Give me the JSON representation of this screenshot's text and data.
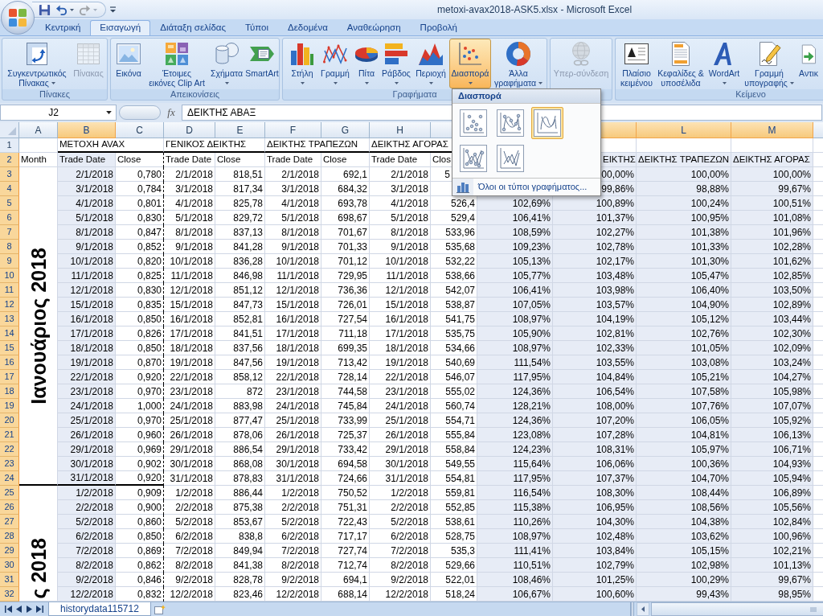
{
  "window": {
    "title": "metoxi-avax2018-ASK5.xlsx - Microsoft Excel"
  },
  "quick_access": [
    {
      "kind": "save",
      "disabled": false,
      "dropdown": false
    },
    {
      "kind": "undo",
      "disabled": false,
      "dropdown": true
    },
    {
      "kind": "redo",
      "disabled": true,
      "dropdown": true
    }
  ],
  "tabs": [
    {
      "label": "Κεντρική",
      "selected": false
    },
    {
      "label": "Εισαγωγή",
      "selected": true
    },
    {
      "label": "Διάταξη σελίδας",
      "selected": false
    },
    {
      "label": "Τύποι",
      "selected": false
    },
    {
      "label": "Δεδομένα",
      "selected": false
    },
    {
      "label": "Αναθεώρηση",
      "selected": false
    },
    {
      "label": "Προβολή",
      "selected": false
    }
  ],
  "ribbon": {
    "groups": [
      {
        "label": "Πίνακες",
        "buttons": [
          {
            "kind": "pivot_table",
            "lines": [
              "Συγκεντρωτικός",
              "Πίνακας"
            ],
            "dropdown": true,
            "disabled": false,
            "pressed": false
          },
          {
            "kind": "table",
            "lines": [
              "Πίνακας"
            ],
            "dropdown": false,
            "disabled": true,
            "pressed": false
          }
        ]
      },
      {
        "label": "Απεικονίσεις",
        "buttons": [
          {
            "kind": "picture",
            "lines": [
              "Εικόνα"
            ],
            "dropdown": false,
            "disabled": false,
            "pressed": false
          },
          {
            "kind": "clip_art",
            "lines": [
              "Έτοιμες",
              "εικόνες Clip Art"
            ],
            "dropdown": false,
            "disabled": false,
            "pressed": false
          },
          {
            "kind": "shapes",
            "lines": [
              "Σχήματα"
            ],
            "dropdown": true,
            "disabled": false,
            "pressed": false
          },
          {
            "kind": "smartart",
            "lines": [
              "SmartArt"
            ],
            "dropdown": false,
            "disabled": false,
            "pressed": false
          }
        ]
      },
      {
        "label": "Γραφήματα",
        "buttons": [
          {
            "kind": "column",
            "lines": [
              "Στήλη"
            ],
            "dropdown": true,
            "disabled": false,
            "pressed": false
          },
          {
            "kind": "line",
            "lines": [
              "Γραμμή"
            ],
            "dropdown": true,
            "disabled": false,
            "pressed": false
          },
          {
            "kind": "pie",
            "lines": [
              "Πίτα"
            ],
            "dropdown": true,
            "disabled": false,
            "pressed": false
          },
          {
            "kind": "bar",
            "lines": [
              "Ράβδος"
            ],
            "dropdown": true,
            "disabled": false,
            "pressed": false
          },
          {
            "kind": "area",
            "lines": [
              "Περιοχή"
            ],
            "dropdown": true,
            "disabled": false,
            "pressed": false
          },
          {
            "kind": "scatter",
            "lines": [
              "Διασπορά"
            ],
            "dropdown": true,
            "disabled": false,
            "pressed": true,
            "menu": {
              "title": "Διασπορά",
              "options": [
                {
                  "kind": "markers",
                  "selected": false
                },
                {
                  "kind": "smooth_markers",
                  "selected": false
                },
                {
                  "kind": "smooth_lines",
                  "selected": true
                },
                {
                  "kind": "straight_markers",
                  "selected": false
                },
                {
                  "kind": "straight_lines",
                  "selected": false
                }
              ],
              "footer_link": "Όλοι οι τύποι γραφήματος..."
            }
          },
          {
            "kind": "other_charts",
            "lines": [
              "Άλλα",
              "γραφήματα"
            ],
            "dropdown": true,
            "disabled": false,
            "pressed": false
          }
        ]
      },
      {
        "buttons": [
          {
            "kind": "hyperlink",
            "lines": [
              "Υπερ-σύνδεση"
            ],
            "dropdown": false,
            "disabled": true,
            "pressed": false
          }
        ]
      },
      {
        "label": "Κείμενο",
        "buttons": [
          {
            "kind": "text_box",
            "lines": [
              "Πλαίσιο",
              "κειμένου"
            ],
            "dropdown": false,
            "disabled": false,
            "pressed": false
          },
          {
            "kind": "header_footer",
            "lines": [
              "Κεφαλίδες &",
              "υποσέλιδα"
            ],
            "dropdown": false,
            "disabled": false,
            "pressed": false
          },
          {
            "kind": "wordart",
            "lines": [
              "WordArt"
            ],
            "dropdown": true,
            "disabled": false,
            "pressed": false
          },
          {
            "kind": "signature_line",
            "lines": [
              "Γραμμή",
              "υπογραφής"
            ],
            "dropdown": true,
            "disabled": false,
            "pressed": false
          },
          {
            "kind": "object",
            "lines": [
              "Αντικ"
            ],
            "dropdown": false,
            "disabled": false,
            "pressed": false
          }
        ]
      }
    ]
  },
  "formula_bar": {
    "name_box": "J2",
    "function_button": "fx",
    "formula": "ΔΕΙΚΤΗΣ ΑΒΑΞ"
  },
  "sheet": {
    "columns": [
      {
        "label": "A",
        "selected": false
      },
      {
        "label": "B",
        "selected": true
      },
      {
        "label": "C",
        "selected": false
      },
      {
        "label": "D",
        "selected": false
      },
      {
        "label": "E",
        "selected": false
      },
      {
        "label": "F",
        "selected": false
      },
      {
        "label": "G",
        "selected": false
      },
      {
        "label": "H",
        "selected": false
      },
      {
        "selected": false
      },
      {
        "selected": true
      },
      {
        "selected": true
      },
      {
        "label": "L",
        "selected": true
      },
      {
        "label": "M",
        "selected": true
      }
    ],
    "header_rows": [
      {
        "number": "1",
        "selected": false,
        "cells": [
          null,
          "ΜΕΤΟΧΗ AVAX",
          null,
          "ΓΕΝΙΚΟΣ ΔΕΙΚΤΗΣ",
          null,
          "ΔΕΙΚΤΗΣ ΤΡΑΠΕΖΩΝ",
          null,
          "ΔΕΙΚΤΗΣ ΑΓΟΡΑΣ",
          null,
          null,
          null,
          null,
          null
        ]
      },
      {
        "number": "2",
        "selected": true,
        "cells": [
          "Month",
          "Trade Date",
          "Close",
          "Trade Date",
          "Close",
          "Trade Date",
          "Close",
          "Trade Date",
          "Clos",
          null,
          "ΕΙΚΤΗΣ",
          "ΔΕΙΚΤΗΣ ΤΡΑΠΕΖΩΝ",
          "ΔΕΙΚΤΗΣ ΑΓΟΡΑΣ"
        ]
      }
    ],
    "month_blocks": [
      {
        "label": "Ιανουάριος 2018",
        "rows": [
          {
            "number": "3",
            "selected": true,
            "cells": [
              "2/1/2018",
              "0,780",
              "2/1/2018",
              "818,51",
              "2/1/2018",
              "692,1",
              "2/1/2018",
              "5",
              null,
              "00,00%",
              "100,00%",
              "100,00%"
            ]
          },
          {
            "number": "4",
            "selected": true,
            "cells": [
              "3/1/2018",
              "0,784",
              "3/1/2018",
              "817,34",
              "3/1/2018",
              "684,32",
              "3/1/2018",
              null,
              null,
              "99,86%",
              "98,88%",
              "99,67%"
            ]
          },
          {
            "number": "5",
            "selected": true,
            "cells": [
              "4/1/2018",
              "0,801",
              "4/1/2018",
              "825,78",
              "4/1/2018",
              "693,78",
              "4/1/2018",
              "526,4",
              "102,69%",
              "100,89%",
              "100,24%",
              "100,51%"
            ]
          },
          {
            "number": "6",
            "selected": true,
            "cells": [
              "5/1/2018",
              "0,830",
              "5/1/2018",
              "829,72",
              "5/1/2018",
              "698,67",
              "5/1/2018",
              "529,4",
              "106,41%",
              "101,37%",
              "100,95%",
              "101,08%"
            ]
          },
          {
            "number": "7",
            "selected": true,
            "cells": [
              "8/1/2018",
              "0,847",
              "8/1/2018",
              "837,13",
              "8/1/2018",
              "701,67",
              "8/1/2018",
              "533,96",
              "108,59%",
              "102,27%",
              "101,38%",
              "101,96%"
            ]
          },
          {
            "number": "8",
            "selected": true,
            "cells": [
              "9/1/2018",
              "0,852",
              "9/1/2018",
              "841,28",
              "9/1/2018",
              "701,33",
              "9/1/2018",
              "535,68",
              "109,23%",
              "102,78%",
              "101,33%",
              "102,28%"
            ]
          },
          {
            "number": "9",
            "selected": true,
            "cells": [
              "10/1/2018",
              "0,820",
              "10/1/2018",
              "836,28",
              "10/1/2018",
              "701,12",
              "10/1/2018",
              "532,22",
              "105,13%",
              "102,17%",
              "101,30%",
              "101,62%"
            ]
          },
          {
            "number": "10",
            "selected": true,
            "cells": [
              "11/1/2018",
              "0,825",
              "11/1/2018",
              "846,98",
              "11/1/2018",
              "729,95",
              "11/1/2018",
              "538,66",
              "105,77%",
              "103,48%",
              "105,47%",
              "102,85%"
            ]
          },
          {
            "number": "11",
            "selected": true,
            "cells": [
              "12/1/2018",
              "0,830",
              "12/1/2018",
              "851,12",
              "12/1/2018",
              "736,36",
              "12/1/2018",
              "542,07",
              "106,41%",
              "103,98%",
              "106,40%",
              "103,50%"
            ]
          },
          {
            "number": "12",
            "selected": true,
            "cells": [
              "15/1/2018",
              "0,835",
              "15/1/2018",
              "847,73",
              "15/1/2018",
              "726,01",
              "15/1/2018",
              "538,87",
              "107,05%",
              "103,57%",
              "104,90%",
              "102,89%"
            ]
          },
          {
            "number": "13",
            "selected": true,
            "cells": [
              "16/1/2018",
              "0,850",
              "16/1/2018",
              "852,81",
              "16/1/2018",
              "727,54",
              "16/1/2018",
              "541,75",
              "108,97%",
              "104,19%",
              "105,12%",
              "103,44%"
            ]
          },
          {
            "number": "14",
            "selected": true,
            "cells": [
              "17/1/2018",
              "0,826",
              "17/1/2018",
              "841,51",
              "17/1/2018",
              "711,18",
              "17/1/2018",
              "535,75",
              "105,90%",
              "102,81%",
              "102,76%",
              "102,30%"
            ]
          },
          {
            "number": "15",
            "selected": true,
            "cells": [
              "18/1/2018",
              "0,850",
              "18/1/2018",
              "837,56",
              "18/1/2018",
              "699,35",
              "18/1/2018",
              "534,66",
              "108,97%",
              "102,33%",
              "101,05%",
              "102,09%"
            ]
          },
          {
            "number": "16",
            "selected": true,
            "cells": [
              "19/1/2018",
              "0,870",
              "19/1/2018",
              "847,56",
              "19/1/2018",
              "713,42",
              "19/1/2018",
              "540,69",
              "111,54%",
              "103,55%",
              "103,08%",
              "103,24%"
            ]
          },
          {
            "number": "17",
            "selected": true,
            "cells": [
              "22/1/2018",
              "0,920",
              "22/1/2018",
              "858,12",
              "22/1/2018",
              "728,14",
              "22/1/2018",
              "546,07",
              "117,95%",
              "104,84%",
              "105,21%",
              "104,27%"
            ]
          },
          {
            "number": "18",
            "selected": true,
            "cells": [
              "23/1/2018",
              "0,970",
              "23/1/2018",
              "872",
              "23/1/2018",
              "744,58",
              "23/1/2018",
              "555,02",
              "124,36%",
              "106,54%",
              "107,58%",
              "105,98%"
            ]
          },
          {
            "number": "19",
            "selected": true,
            "cells": [
              "24/1/2018",
              "1,000",
              "24/1/2018",
              "883,98",
              "24/1/2018",
              "745,84",
              "24/1/2018",
              "560,74",
              "128,21%",
              "108,00%",
              "107,76%",
              "107,07%"
            ]
          },
          {
            "number": "20",
            "selected": true,
            "cells": [
              "25/1/2018",
              "0,970",
              "25/1/2018",
              "877,47",
              "25/1/2018",
              "733,99",
              "25/1/2018",
              "554,71",
              "124,36%",
              "107,20%",
              "106,05%",
              "105,92%"
            ]
          },
          {
            "number": "21",
            "selected": true,
            "cells": [
              "26/1/2018",
              "0,960",
              "26/1/2018",
              "878,06",
              "26/1/2018",
              "725,37",
              "26/1/2018",
              "555,84",
              "123,08%",
              "107,28%",
              "104,81%",
              "106,13%"
            ]
          },
          {
            "number": "22",
            "selected": true,
            "cells": [
              "29/1/2018",
              "0,969",
              "29/1/2018",
              "886,54",
              "29/1/2018",
              "733,42",
              "29/1/2018",
              "558,84",
              "124,23%",
              "108,31%",
              "105,97%",
              "106,71%"
            ]
          },
          {
            "number": "23",
            "selected": true,
            "cells": [
              "30/1/2018",
              "0,902",
              "30/1/2018",
              "868,08",
              "30/1/2018",
              "694,58",
              "30/1/2018",
              "549,55",
              "115,64%",
              "106,06%",
              "100,36%",
              "104,93%"
            ]
          },
          {
            "number": "24",
            "selected": true,
            "cells": [
              "31/1/2018",
              "0,920",
              "31/1/2018",
              "878,83",
              "31/1/2018",
              "724,66",
              "31/1/2018",
              "554,81",
              "117,95%",
              "107,37%",
              "104,70%",
              "105,94%"
            ]
          }
        ]
      },
      {
        "label": "ς 2018",
        "rows": [
          {
            "number": "25",
            "selected": true,
            "cells": [
              "1/2/2018",
              "0,909",
              "1/2/2018",
              "886,44",
              "1/2/2018",
              "750,52",
              "1/2/2018",
              "559,81",
              "116,54%",
              "108,30%",
              "108,44%",
              "106,89%"
            ]
          },
          {
            "number": "26",
            "selected": true,
            "cells": [
              "2/2/2018",
              "0,900",
              "2/2/2018",
              "875,38",
              "2/2/2018",
              "751,31",
              "2/2/2018",
              "552,85",
              "115,38%",
              "106,95%",
              "108,56%",
              "105,56%"
            ]
          },
          {
            "number": "27",
            "selected": true,
            "cells": [
              "5/2/2018",
              "0,860",
              "5/2/2018",
              "853,67",
              "5/2/2018",
              "722,43",
              "5/2/2018",
              "538,61",
              "110,26%",
              "104,30%",
              "104,38%",
              "102,84%"
            ]
          },
          {
            "number": "28",
            "selected": true,
            "cells": [
              "6/2/2018",
              "0,850",
              "6/2/2018",
              "838,8",
              "6/2/2018",
              "717,17",
              "6/2/2018",
              "528,75",
              "108,97%",
              "102,48%",
              "103,62%",
              "100,96%"
            ]
          },
          {
            "number": "29",
            "selected": true,
            "cells": [
              "7/2/2018",
              "0,869",
              "7/2/2018",
              "849,94",
              "7/2/2018",
              "727,74",
              "7/2/2018",
              "535,3",
              "111,41%",
              "103,84%",
              "105,15%",
              "102,21%"
            ]
          },
          {
            "number": "30",
            "selected": true,
            "cells": [
              "8/2/2018",
              "0,862",
              "8/2/2018",
              "841,38",
              "8/2/2018",
              "712,74",
              "8/2/2018",
              "529,66",
              "110,51%",
              "102,79%",
              "102,98%",
              "101,13%"
            ]
          },
          {
            "number": "31",
            "selected": true,
            "cells": [
              "9/2/2018",
              "0,846",
              "9/2/2018",
              "828,78",
              "9/2/2018",
              "694,1",
              "9/2/2018",
              "522,01",
              "108,46%",
              "101,25%",
              "100,29%",
              "99,67%"
            ]
          },
          {
            "number": "32",
            "selected": true,
            "cells": [
              "12/2/2018",
              "0,832",
              "12/2/2018",
              "823,46",
              "12/2/2018",
              "688,14",
              "12/2/2018",
              "518,24",
              "106,67%",
              "100,60%",
              "99,43%",
              "98,95%"
            ]
          }
        ]
      }
    ]
  },
  "sheet_tabs": [
    {
      "label": "historydata115712",
      "selected": true
    }
  ]
}
